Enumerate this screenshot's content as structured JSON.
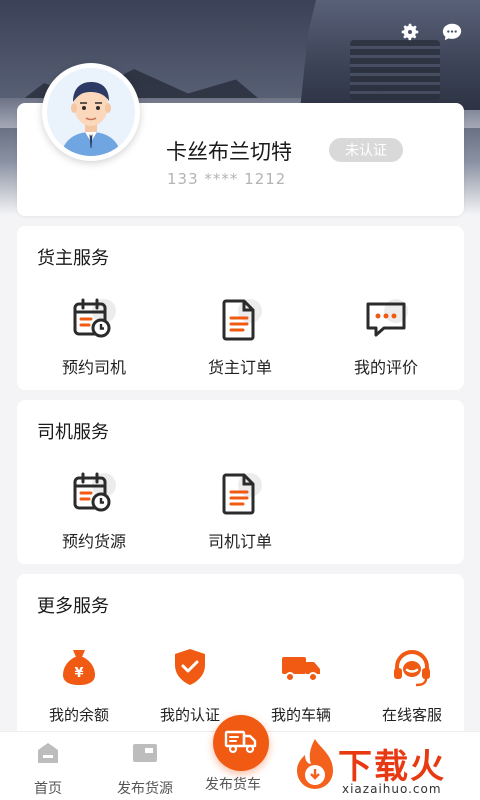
{
  "header": {
    "icons": [
      "gear-icon",
      "chat-bubble-icon"
    ]
  },
  "profile": {
    "name": "卡丝布兰切特",
    "verify_status": "未认证",
    "phone": "133 **** 1212"
  },
  "shipper_services": {
    "title": "货主服务",
    "items": [
      {
        "label": "预约司机",
        "icon": "calendar-clock-icon"
      },
      {
        "label": "货主订单",
        "icon": "document-icon"
      },
      {
        "label": "我的评价",
        "icon": "comment-icon"
      }
    ]
  },
  "driver_services": {
    "title": "司机服务",
    "items": [
      {
        "label": "预约货源",
        "icon": "calendar-clock-icon"
      },
      {
        "label": "司机订单",
        "icon": "document-icon"
      }
    ]
  },
  "more_services": {
    "title": "更多服务",
    "items": [
      {
        "label": "我的余额",
        "icon": "money-bag-icon"
      },
      {
        "label": "我的认证",
        "icon": "shield-check-icon"
      },
      {
        "label": "我的车辆",
        "icon": "truck-icon"
      },
      {
        "label": "在线客服",
        "icon": "headset-icon"
      }
    ]
  },
  "bottom_nav": {
    "home": "首页",
    "publish_cargo": "发布货源",
    "publish_truck": "发布货车"
  },
  "watermark": {
    "text": "下载火",
    "sub": "xiazaihuo.com"
  },
  "colors": {
    "accent": "#f05a12",
    "dark_icon": "#2b2b2b",
    "badge_bg": "#d9d9d9"
  }
}
